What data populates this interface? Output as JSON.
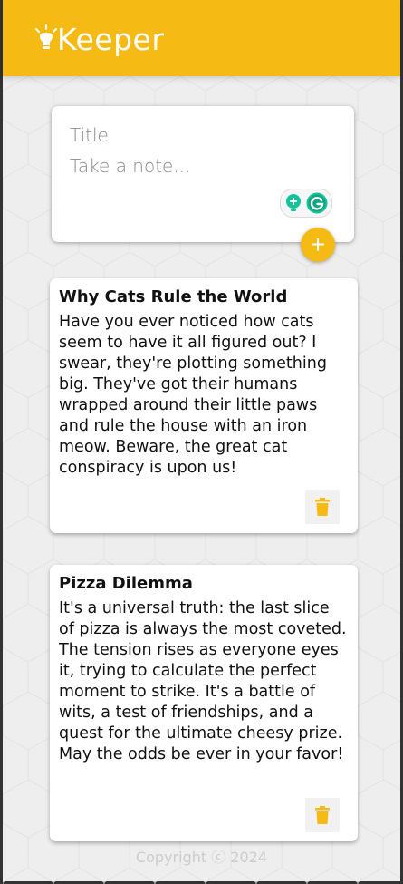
{
  "header": {
    "app_name": "Keeper",
    "logo_icon": "lightbulb-icon"
  },
  "create_note": {
    "title_placeholder": "Title",
    "content_placeholder": "Take a note...",
    "add_icon": "plus-icon",
    "add_label": "+"
  },
  "notes": [
    {
      "title": "Why Cats Rule the World",
      "content": "Have you ever noticed how cats seem to have it all figured out? I swear, they're plotting something big. They've got their humans wrapped around their little paws and rule the house with an iron meow. Beware, the great cat conspiracy is upon us!",
      "delete_icon": "trash-icon"
    },
    {
      "title": "Pizza Dilemma",
      "content": "It's a universal truth: the last slice of pizza is always the most coveted. The tension rises as everyone eyes it, trying to calculate the perfect moment to strike. It's a battle of wits, a test of friendships, and a quest for the ultimate cheesy prize. May the odds be ever in your favor!",
      "delete_icon": "trash-icon"
    }
  ],
  "footer": {
    "copyright": "Copyright ⓒ 2024"
  },
  "colors": {
    "accent": "#f5ba13",
    "background": "#eeeeee",
    "card": "#ffffff",
    "grammarly": "#15c39a"
  }
}
